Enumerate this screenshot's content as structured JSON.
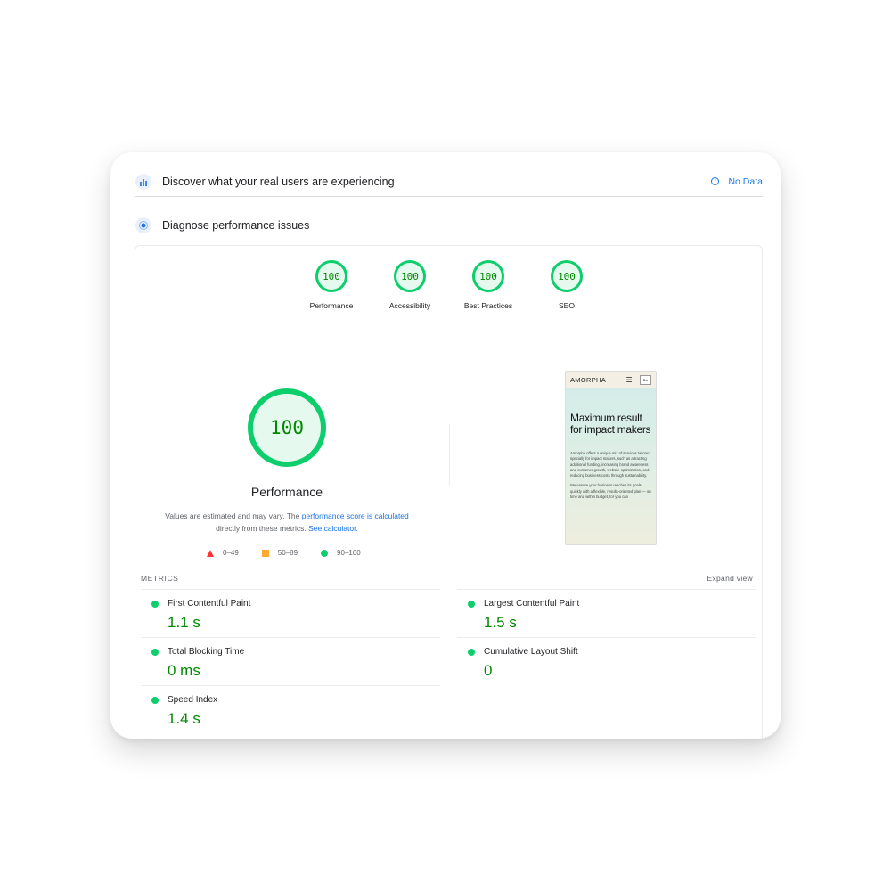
{
  "discover": {
    "title": "Discover what your real users are experiencing",
    "status": "No Data",
    "icon": "users-chart-icon"
  },
  "diagnose": {
    "title": "Diagnose performance issues",
    "icon": "lighthouse-icon"
  },
  "categories": [
    {
      "score": "100",
      "label": "Performance"
    },
    {
      "score": "100",
      "label": "Accessibility"
    },
    {
      "score": "100",
      "label": "Best Practices"
    },
    {
      "score": "100",
      "label": "SEO"
    }
  ],
  "main_gauge": {
    "score": "100",
    "label": "Performance"
  },
  "note": {
    "text1": "Values are estimated and may vary. The ",
    "link1": "performance score is calculated",
    "text2": " directly from these metrics. ",
    "link2": "See calculator."
  },
  "legend": {
    "fail": "0–49",
    "average": "50–89",
    "pass": "90–100"
  },
  "colors": {
    "pass": "#0cce6b",
    "average": "#ffaa33",
    "fail": "#ff3333",
    "link": "#1a73e8",
    "pass_text": "#008800"
  },
  "thumbnail": {
    "brand": "AMORPHA",
    "button": "Bu",
    "headline": "Maximum result for impact makers",
    "para1": "Amorpha offers a unique mix of services tailored specially for impact makers, such as attracting additional funding, increasing brand awareness and customer growth, website optimization, and reducing business costs through sustainability.",
    "para2": "We ensure your business reaches its goals quickly with a flexible, results-oriented plan — on time and within budget, for you can"
  },
  "metrics": {
    "header": "METRICS",
    "expand": "Expand view",
    "items": [
      {
        "name": "First Contentful Paint",
        "value": "1.1 s"
      },
      {
        "name": "Largest Contentful Paint",
        "value": "1.5 s"
      },
      {
        "name": "Total Blocking Time",
        "value": "0 ms"
      },
      {
        "name": "Cumulative Layout Shift",
        "value": "0"
      },
      {
        "name": "Speed Index",
        "value": "1.4 s"
      }
    ]
  }
}
